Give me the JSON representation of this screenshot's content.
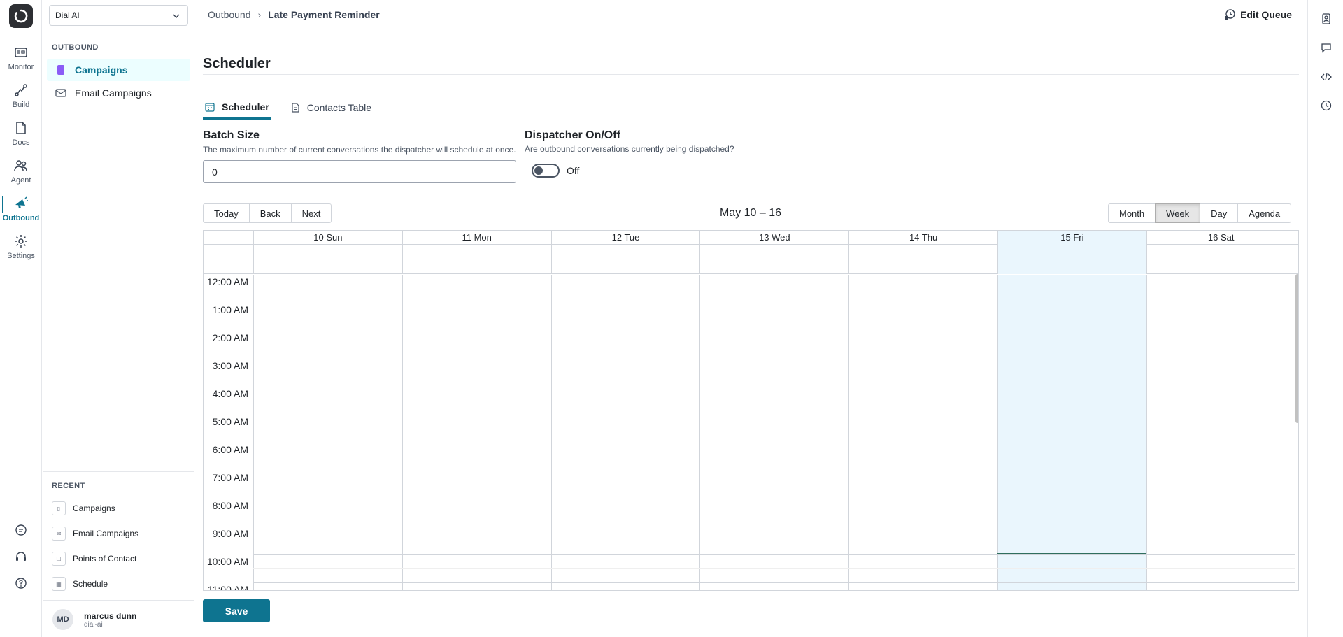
{
  "rail": {
    "items": [
      {
        "label": "Monitor",
        "icon": "monitor-icon"
      },
      {
        "label": "Build",
        "icon": "build-icon"
      },
      {
        "label": "Docs",
        "icon": "docs-icon"
      },
      {
        "label": "Agent",
        "icon": "agent-icon"
      },
      {
        "label": "Outbound",
        "icon": "outbound-icon",
        "active": true
      },
      {
        "label": "Settings",
        "icon": "gear-icon"
      }
    ],
    "bottom_icons": [
      "chat-icon",
      "headset-icon",
      "help-icon"
    ]
  },
  "sidebar": {
    "workspace": "Dial AI",
    "section_title": "OUTBOUND",
    "items": [
      {
        "label": "Campaigns",
        "icon": "campaign-icon",
        "active": true
      },
      {
        "label": "Email Campaigns",
        "icon": "email-icon"
      }
    ],
    "recent_title": "RECENT",
    "recent": [
      {
        "label": "Campaigns"
      },
      {
        "label": "Email Campaigns"
      },
      {
        "label": "Points of Contact"
      },
      {
        "label": "Schedule"
      }
    ],
    "user": {
      "initials": "MD",
      "name": "marcus dunn",
      "org": "dial-ai"
    }
  },
  "breadcrumb": {
    "parent": "Outbound",
    "current": "Late Payment Reminder"
  },
  "edit_queue_label": "Edit Queue",
  "page_title": "Scheduler",
  "tabs": [
    {
      "label": "Scheduler",
      "active": true
    },
    {
      "label": "Contacts Table"
    }
  ],
  "batch": {
    "label": "Batch Size",
    "help": "The maximum number of current conversations the dispatcher will schedule at once.",
    "value": "0"
  },
  "dispatcher": {
    "label": "Dispatcher On/Off",
    "help": "Are outbound conversations currently being dispatched?",
    "state_label": "Off",
    "on": false
  },
  "calendar": {
    "nav": {
      "today": "Today",
      "back": "Back",
      "next": "Next"
    },
    "range_label": "May 10 – 16",
    "views": {
      "month": "Month",
      "week": "Week",
      "day": "Day",
      "agenda": "Agenda",
      "active": "Week"
    },
    "days": [
      "10 Sun",
      "11 Mon",
      "12 Tue",
      "13 Wed",
      "14 Thu",
      "15 Fri",
      "16 Sat"
    ],
    "today_index": 5,
    "hours": [
      "12:00 AM",
      "1:00 AM",
      "2:00 AM",
      "3:00 AM",
      "4:00 AM",
      "5:00 AM",
      "6:00 AM",
      "7:00 AM",
      "8:00 AM",
      "9:00 AM",
      "10:00 AM",
      "11:00 AM"
    ]
  },
  "save_label": "Save",
  "colors": {
    "accent": "#0e7490",
    "today_bg": "#eaf6fd"
  }
}
